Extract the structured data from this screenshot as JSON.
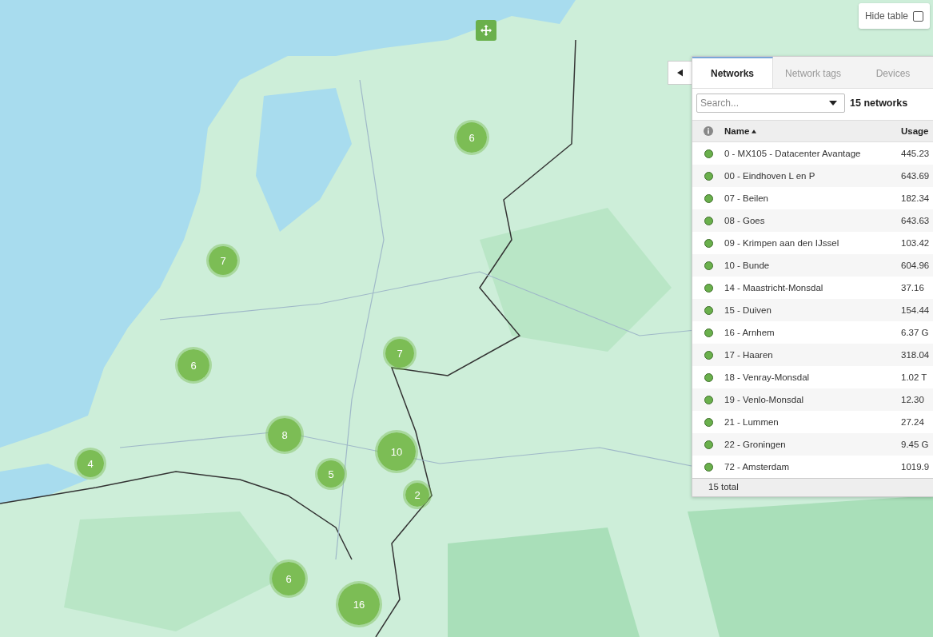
{
  "markers": [
    {
      "kind": "device"
    },
    {
      "kind": "cluster",
      "count": "6"
    },
    {
      "kind": "cluster",
      "count": "7"
    },
    {
      "kind": "cluster",
      "count": "6"
    },
    {
      "kind": "cluster",
      "count": "7"
    },
    {
      "kind": "cluster",
      "count": "8"
    },
    {
      "kind": "cluster",
      "count": "10"
    },
    {
      "kind": "cluster",
      "count": "4"
    },
    {
      "kind": "cluster",
      "count": "5"
    },
    {
      "kind": "cluster",
      "count": "2"
    },
    {
      "kind": "cluster",
      "count": "6"
    },
    {
      "kind": "cluster",
      "count": "16"
    }
  ],
  "hide_table": {
    "label": "Hide table",
    "checked": false
  },
  "tabs": [
    {
      "label": "Networks",
      "selected": true
    },
    {
      "label": "Network tags",
      "selected": false
    },
    {
      "label": "Devices",
      "selected": false
    }
  ],
  "search": {
    "placeholder": "Search..."
  },
  "count_label": "15 networks",
  "table": {
    "columns": [
      "Name",
      "Usage"
    ],
    "rows": [
      {
        "name": "0 - MX105 - Datacenter Avantage",
        "usage": "445.23",
        "color": "#6ab04c"
      },
      {
        "name": "00 - Eindhoven L en P",
        "usage": "643.69",
        "color": "#6ab04c"
      },
      {
        "name": "07 - Beilen",
        "usage": "182.34",
        "color": "#6ab04c"
      },
      {
        "name": "08 - Goes",
        "usage": "643.63",
        "color": "#6ab04c"
      },
      {
        "name": "09 - Krimpen aan den IJssel",
        "usage": "103.42",
        "color": "#6ab04c"
      },
      {
        "name": "10 - Bunde",
        "usage": "604.96",
        "color": "#6ab04c"
      },
      {
        "name": "14 - Maastricht-Monsdal",
        "usage": "37.16",
        "color": "#6ab04c"
      },
      {
        "name": "15 - Duiven",
        "usage": "154.44",
        "color": "#6ab04c"
      },
      {
        "name": "16 - Arnhem",
        "usage": "6.37 G",
        "color": "#6ab04c"
      },
      {
        "name": "17 - Haaren",
        "usage": "318.04",
        "color": "#6ab04c"
      },
      {
        "name": "18 - Venray-Monsdal",
        "usage": "1.02 T",
        "color": "#6ab04c"
      },
      {
        "name": "19 - Venlo-Monsdal",
        "usage": "12.30",
        "color": "#6ab04c"
      },
      {
        "name": "21 - Lummen",
        "usage": "27.24",
        "color": "#6ab04c"
      },
      {
        "name": "22 - Groningen",
        "usage": "9.45 G",
        "color": "#6ab04c"
      },
      {
        "name": "72 - Amsterdam",
        "usage": "1019.9",
        "color": "#6ab04c"
      }
    ],
    "footer": "15 total"
  }
}
